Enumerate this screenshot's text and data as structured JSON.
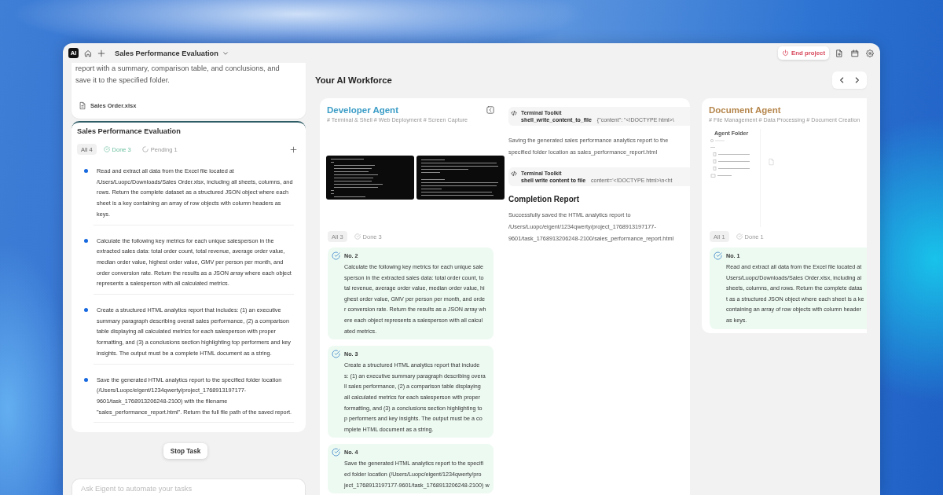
{
  "window": {
    "logo": "AI",
    "title": "Sales Performance Evaluation",
    "end_button": "End project"
  },
  "chat": {
    "message": "report with a summary, comparison table, and conclusions, and save it to the specified folder.",
    "attachment": "Sales Order.xlsx"
  },
  "task_panel": {
    "title": "Sales Performance Evaluation",
    "filters": [
      {
        "label": "All 4",
        "kind": "all",
        "selected": true
      },
      {
        "label": "Done 3",
        "kind": "done",
        "selected": false
      },
      {
        "label": "Pending 1",
        "kind": "pending",
        "selected": false
      }
    ],
    "tasks": [
      "Read and extract all data from the Excel file located at /Users/Luopc/Downloads/Sales Order.xlsx, including all sheets, columns, and rows. Return the complete dataset as a structured JSON object where each sheet is a key containing an array of row objects with column headers as keys.",
      "Calculate the following key metrics for each unique salesperson in the extracted sales data: total order count, total revenue, average order value, median order value, highest order value, GMV per person per month, and order conversion rate. Return the results as a JSON array where each object represents a salesperson with all calculated metrics.",
      "Create a structured HTML analytics report that includes: (1) an executive summary paragraph describing overall sales performance, (2) a comparison table displaying all calculated metrics for each salesperson with proper formatting, and (3) a conclusions section highlighting top performers and key insights. The output must be a complete HTML document as a string.",
      "Save the generated HTML analytics report to the specified folder location (/Users/Luopc/eigent/1234qwerty/project_1768913197177-9601/task_1768913206248-2100) with the filename \"sales_performance_report.html\". Return the full file path of the saved report."
    ]
  },
  "stop_button": "Stop Task",
  "input": {
    "placeholder": "Ask Eigent to automate your tasks"
  },
  "workforce": {
    "title": "Your AI Workforce",
    "agents": [
      {
        "name": "Developer Agent",
        "color": "#3a9cc6",
        "expanded": true,
        "tags": "# Terminal & Shell # Web Deployment # Screen Capture",
        "previews": [
          {
            "kind": "terminal"
          },
          {
            "kind": "terminal"
          }
        ],
        "filters": [
          {
            "label": "All 3",
            "kind": "all",
            "selected": true
          },
          {
            "label": "Done 3",
            "kind": "done",
            "selected": false
          }
        ],
        "tasks": [
          {
            "number": "No. 2",
            "done": true,
            "lines": [
              "Calculate the following key metrics for each unique sale",
              "sperson in the extracted sales data: total order count, to",
              "tal revenue, average order value, median order value, hi",
              "ghest order value, GMV per person per month, and orde",
              "r conversion rate. Return the results as a JSON array wh",
              "ere each object represents a salesperson with all calcul",
              "ated metrics."
            ]
          },
          {
            "number": "No. 3",
            "done": true,
            "lines": [
              "Create a structured HTML analytics report that include",
              "s: (1) an executive summary paragraph describing overa",
              "ll sales performance, (2) a comparison table displaying",
              "all calculated metrics for each salesperson with proper",
              "formatting, and (3) a conclusions section highlighting to",
              "p performers and key insights. The output must be a co",
              "mplete HTML document as a string."
            ]
          },
          {
            "number": "No. 4",
            "done": true,
            "lines": [
              "Save the generated HTML analytics report to the specifi",
              "ed folder location (/Users/Luopc/eigent/1234qwerty/pro",
              "ject_1768913197177-9601/task_1768913206248-2100) w"
            ]
          }
        ],
        "log": [
          {
            "kind": "tool",
            "toolkit": "Terminal Toolkit",
            "command": "shell_write_content_to_file",
            "args": "{\"content\": \"<!DOCTYPE html>\\"
          },
          {
            "kind": "message",
            "text": "Saving the generated sales performance analytics report to the specified folder location as sales_performance_report.html"
          },
          {
            "kind": "tool",
            "toolkit": "Terminal Toolkit",
            "command": "shell write content to file",
            "args": "content='<!DOCTYPE html>\\n<ht"
          },
          {
            "kind": "report",
            "title": "Completion Report",
            "text": "Successfully saved the HTML analytics report to /Users/Luopc/eigent/1234qwerty/project_1768913197177-9601/task_1768913206248-2100/sales_performance_report.html"
          }
        ]
      },
      {
        "name": "Document Agent",
        "color": "#b5864c",
        "expanded": false,
        "tags": "# File Management # Data Processing # Document Creation",
        "previews": [
          {
            "kind": "file-browser",
            "title": "Agent Folder"
          }
        ],
        "filters": [
          {
            "label": "All 1",
            "kind": "all",
            "selected": true
          },
          {
            "label": "Done 1",
            "kind": "done",
            "selected": false
          }
        ],
        "tasks": [
          {
            "number": "No. 1",
            "done": true,
            "lines": [
              "Read and extract all data from the Excel file located at",
              "Users/Luopc/Downloads/Sales Order.xlsx, including al",
              "sheets, columns, and rows. Return the complete datas",
              "t as a structured JSON object where each sheet is a ke",
              "containing an array of row objects with column header",
              "as keys."
            ]
          }
        ]
      }
    ]
  }
}
